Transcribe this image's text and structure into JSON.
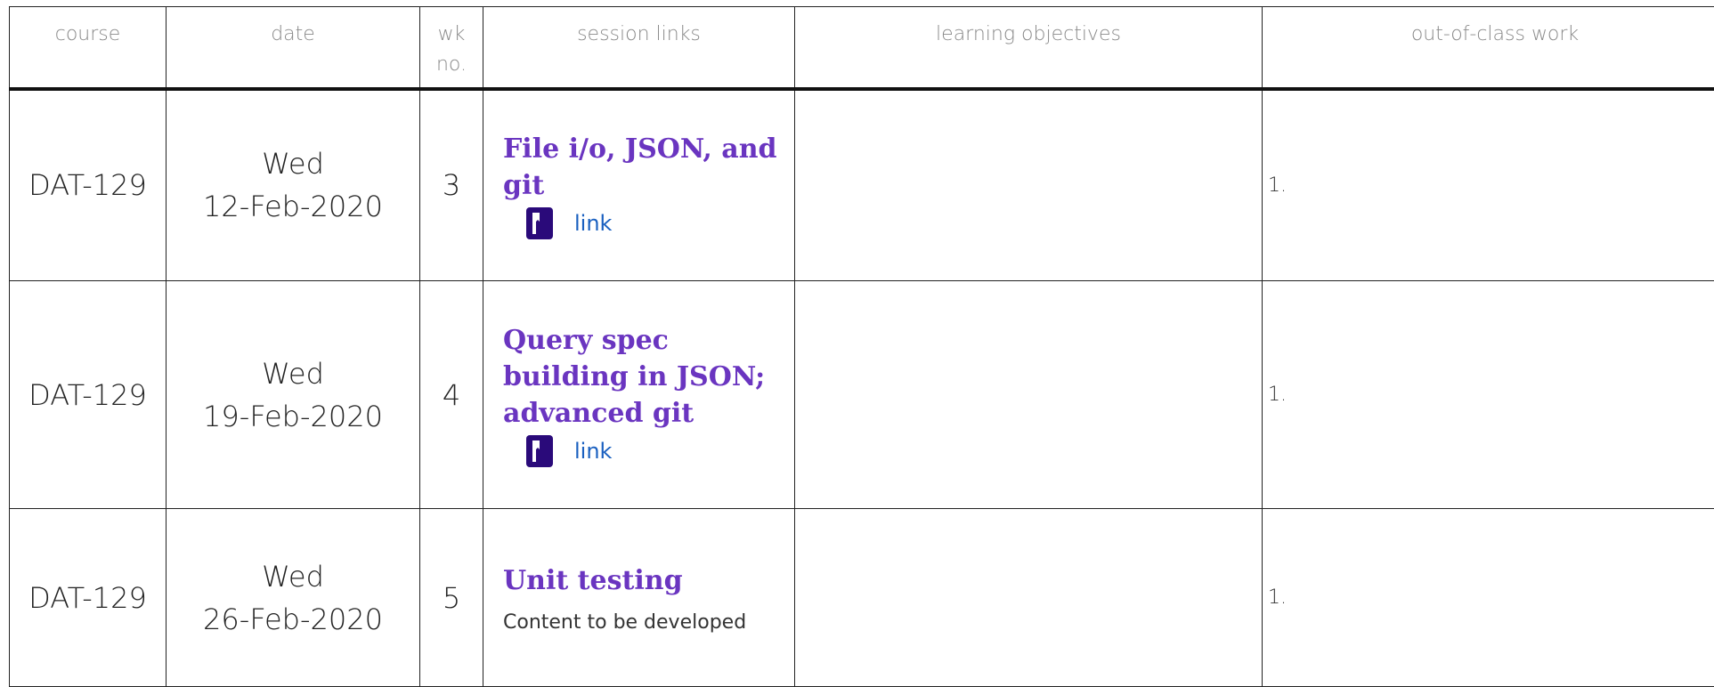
{
  "headers": {
    "course": "course",
    "date": "date",
    "wk": "wk no.",
    "session": "session links",
    "objectives": "learning objectives",
    "work": "out-of-class work"
  },
  "rows": [
    {
      "course": "DAT-129",
      "day": "Wed",
      "date": "12-Feb-2020",
      "week": "3",
      "title": "File i/o, JSON, and git",
      "link_label": "link",
      "link_icon": "book-icon",
      "work": "1."
    },
    {
      "course": "DAT-129",
      "day": "Wed",
      "date": "19-Feb-2020",
      "week": "4",
      "title": "Query spec building in JSON; advanced git",
      "link_label": "link",
      "link_icon": "book-icon",
      "work": "1."
    },
    {
      "course": "DAT-129",
      "day": "Wed",
      "date": "26-Feb-2020",
      "week": "5",
      "title": "Unit testing",
      "note": "Content to be developed",
      "work": "1."
    }
  ],
  "colors": {
    "title": "#6a35c0",
    "link": "#1a60c0",
    "icon": "#2a0a7a",
    "header_text": "#8a8a8a"
  }
}
